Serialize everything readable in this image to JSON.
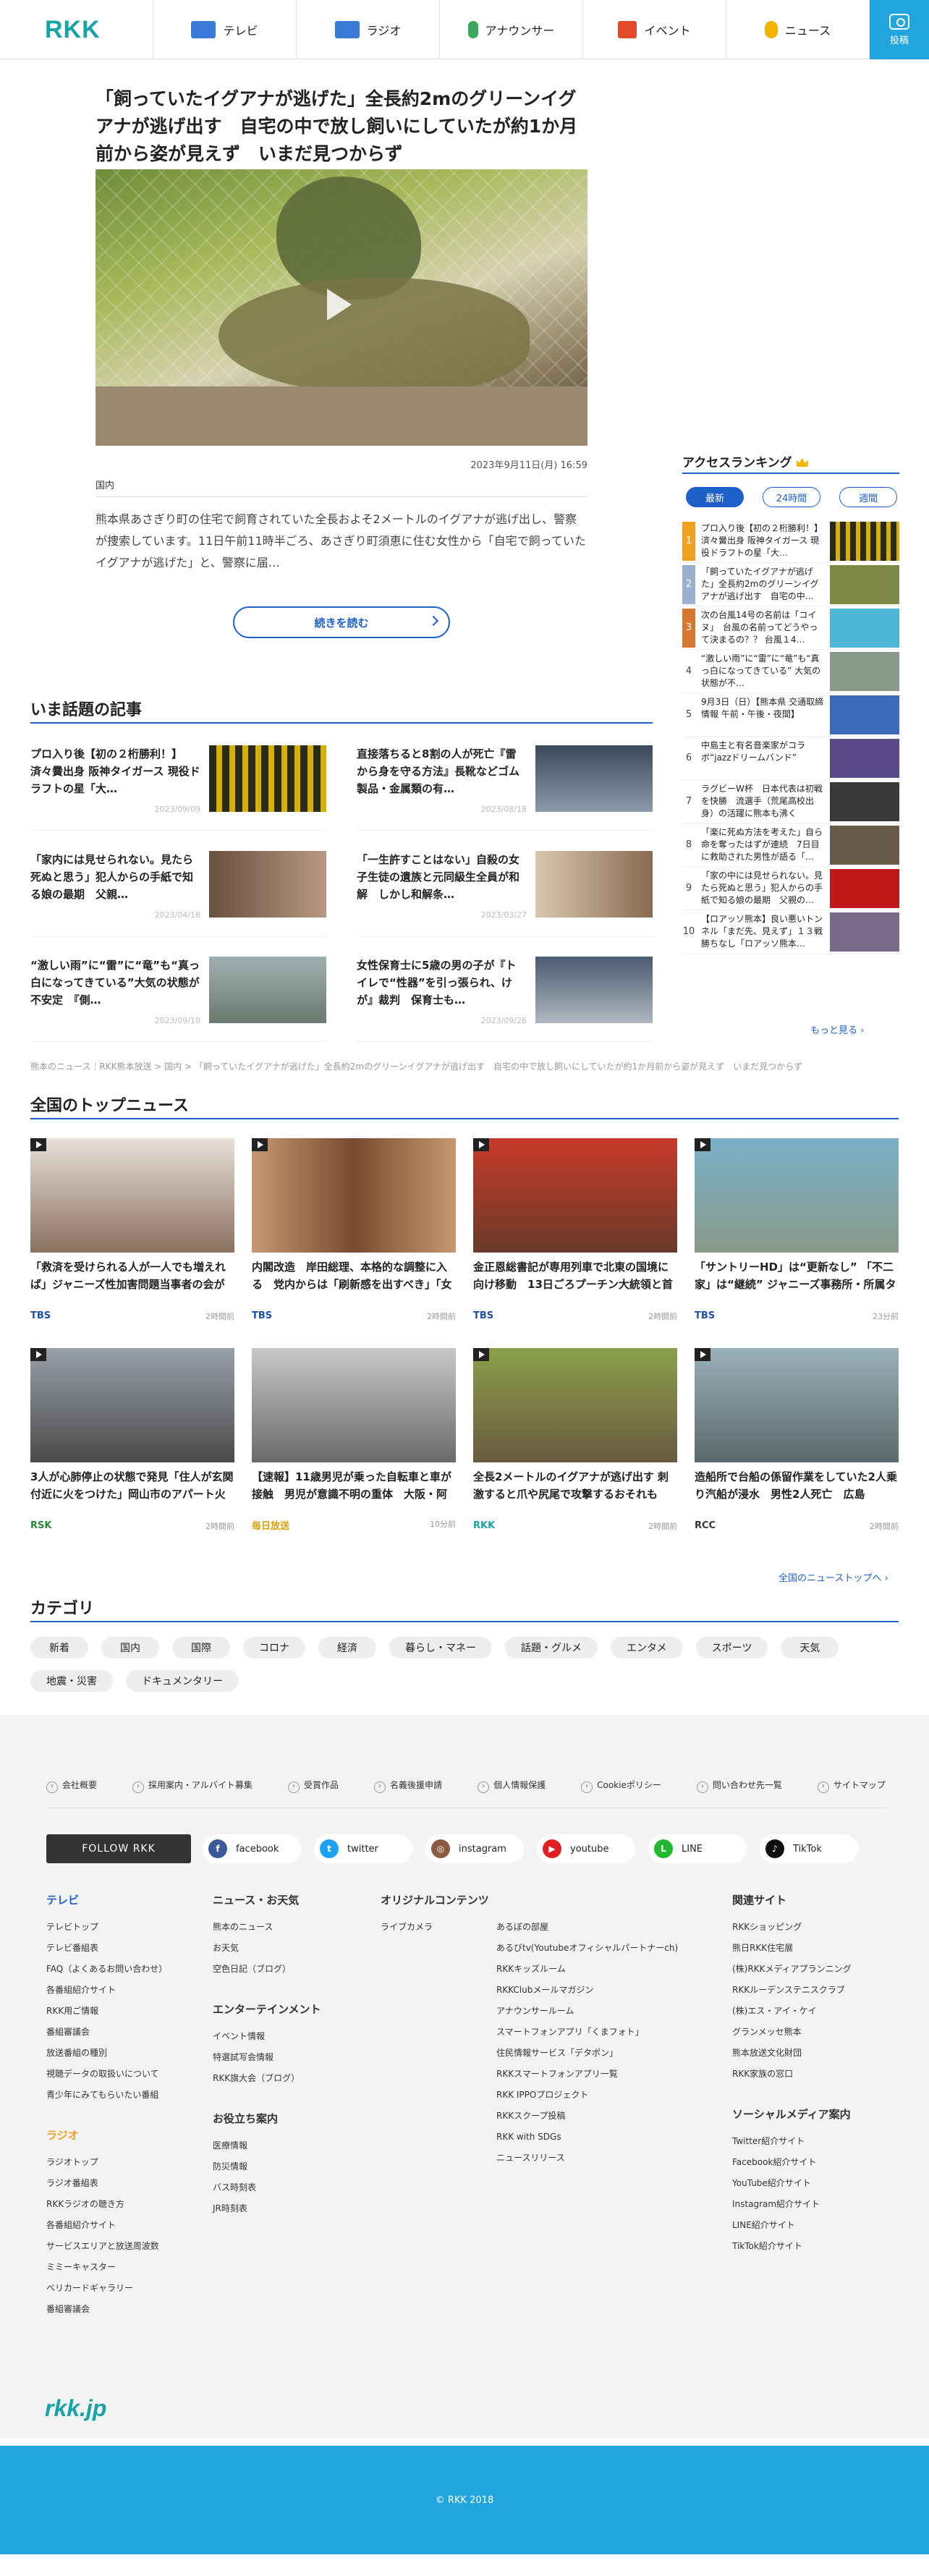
{
  "header": {
    "logo": "RKK",
    "nav": [
      {
        "label": "テレビ",
        "icon": "tv-icon",
        "color": "#3b7bd8"
      },
      {
        "label": "ラジオ",
        "icon": "radio-icon",
        "color": "#3b7bd8"
      },
      {
        "label": "アナウンサー",
        "icon": "microphone-icon",
        "color": "#3aa85c"
      },
      {
        "label": "イベント",
        "icon": "flag-icon",
        "color": "#e04a2a"
      },
      {
        "label": "ニュース",
        "icon": "lightbulb-icon",
        "color": "#f0b400"
      }
    ],
    "post_label": "投稿"
  },
  "article": {
    "title": "「飼っていたイグアナが逃げた」全長約2mのグリーンイグアナが逃げ出す　自宅の中で放し飼いにしていたが約1か月前から姿が見えず　いまだ見つからず",
    "date": "2023年9月11日(月) 16:59",
    "category": "国内",
    "summary": "熊本県あさぎり町の住宅で飼育されていた全長およそ2メートルのイグアナが逃げ出し、警察が捜索しています。11日午前11時半ごろ、あさぎり町須恵に住む女性から「自宅で飼っていたイグアナが逃げた」と、警察に届…",
    "more_label": "続きを読む"
  },
  "ranking": {
    "title": "アクセスランキング",
    "tabs": [
      "最新",
      "24時間",
      "週間"
    ],
    "items": [
      {
        "num": "1",
        "text": "プロ入り後【初の２桁勝利！】済々黌出身 阪神タイガース 現役ドラフトの星「大…",
        "color": "#2a2a1a"
      },
      {
        "num": "2",
        "text": "「飼っていたイグアナが逃げた」全長約2mのグリーンイグアナが逃げ出す　自宅の中…",
        "color": "#7c8a46"
      },
      {
        "num": "3",
        "text": "次の台風14号の名前は「コイヌ」　台風の名前ってどうやって決まるの？？ 台風１4…",
        "color": "#4fb6d8"
      },
      {
        "num": "4",
        "text": "“激しい雨”に“雷”に“竜”も“真っ白になってきている” 大気の状態が不…",
        "color": "#8a9a8a"
      },
      {
        "num": "5",
        "text": "9月3日（日）【熊本県 交通取締情報 午前・午後・夜間】",
        "color": "#3a6ab8"
      },
      {
        "num": "6",
        "text": "中島主と有名音楽家がコラボ“jazzドリームバンド”",
        "color": "#5a4a8a"
      },
      {
        "num": "7",
        "text": "ラグビーW杯　日本代表は初戦を快勝　流選手（荒尾高校出身）の活躍に熊本も沸く",
        "color": "#3a3a3a"
      },
      {
        "num": "8",
        "text": "「楽に死ぬ方法を考えた」自ら命を奪ったはずが連続　7日目に救助された男性が語る「…",
        "color": "#6a5a4a"
      },
      {
        "num": "9",
        "text": "「家の中には見せられない。見たら死ぬと思う」犯人からの手紙で知る娘の最期　父親の…",
        "color": "#c01818"
      },
      {
        "num": "10",
        "text": "【ロアッソ熊本】良い悪いトンネル「まだ先、見えず」１３戦勝ちなし「ロアッソ熊本…",
        "color": "#7a6a8a"
      }
    ],
    "more_label": "もっと見る ›"
  },
  "trending": {
    "title": "いま話題の記事",
    "items": [
      {
        "title": "プロ入り後【初の２桁勝利！】済々黌出身 阪神タイガース 現役ドラフトの星「大…",
        "date": "2023/09/09",
        "color": "#d8b000"
      },
      {
        "title": "直接落ちると8割の人が死亡『雷から身を守る方法』長靴などゴム製品・金属類の有…",
        "date": "2023/08/18",
        "color": "#5c6a7a"
      },
      {
        "title": "「家内には見せられない。見たら死ぬと思う」犯人からの手紙で知る娘の最期　父親…",
        "date": "2023/04/18",
        "color": "#6a5040"
      },
      {
        "title": "「一生許すことはない」自殺の女子生徒の遺族と元同級生全員が和解　しかし和解条…",
        "date": "2023/03/27",
        "color": "#b8a890"
      },
      {
        "title": "“激しい雨”に“雷”に“竜”も“真っ白になってきている”大気の状態が不安定　『側…",
        "date": "2023/09/10",
        "color": "#8a9a90"
      },
      {
        "title": "女性保育士に5歳の男の子が『トイレで“性器”を引っ張られ、けが』裁判　保育士も…",
        "date": "2023/09/26",
        "color": "#6a7a8a"
      }
    ]
  },
  "breadcrumb": "熊本のニュース｜RKK熊本放送 > 国内 > 「飼っていたイグアナが逃げた」全長約2mのグリーンイグアナが逃げ出す　自宅の中で放し飼いにしていたが約1か月前から姿が見えず　いまだ見つからず",
  "national": {
    "title": "全国のトップニュース",
    "items": [
      {
        "title": "「救済を受けられる人が一人でも増えれば」ジャニーズ性加害問題当事者の会が日弁連に対し人権救済申し立て",
        "source": "TBS",
        "time": "2時間前",
        "color": "#8a7060",
        "src_color": "#1f4fa8"
      },
      {
        "title": "内閣改造　岸田総理、本格的な調整に入る　党内からは「刷新感を出すべき」「女性閣僚を増やすべき」など…",
        "source": "TBS",
        "time": "2時間前",
        "color": "#7a4a30",
        "src_color": "#1f4fa8"
      },
      {
        "title": "金正恩総書記が専用列車で北東の国境に向け移動　13日ごろプーチン大統領と首脳会談か　韓国メディアが報道",
        "source": "TBS",
        "time": "2時間前",
        "color": "#8a3a2a",
        "src_color": "#1f4fa8"
      },
      {
        "title": "「サントリーHD」は“更新なし” 「不二家」は“継続” ジャニーズ事務所・所属タレントの広告契約で対応わかれる",
        "source": "TBS",
        "time": "23分前",
        "color": "#6a8a9a",
        "src_color": "#1f4fa8"
      },
      {
        "title": "3人が心肺停止の状態で発見「住人が玄関付近に火をつけた」岡山市のアパート火災",
        "source": "RSK",
        "time": "2時間前",
        "color": "#5a5a5a",
        "src_color": "#2a8a3a"
      },
      {
        "title": "【速報】11歳男児が乗った自転車と車が接触　男児が意識不明の重体　大阪・阿倍野区",
        "source": "毎日放送",
        "time": "10分前",
        "color": "#9a9a9a",
        "src_color": "#d8a000"
      },
      {
        "title": "全長2メートルのイグアナが逃げ出す 刺激すると爪や尻尾で攻撃するおそれも　熊本",
        "source": "RKK",
        "time": "2時間前",
        "color": "#6a7a3a",
        "src_color": "#18a3a8"
      },
      {
        "title": "造船所で台船の係留作業をしていた2人乗り汽船が浸水　男性2人死亡　広島",
        "source": "RCC",
        "time": "2時間前",
        "color": "#6a7a80",
        "src_color": "#333333"
      }
    ],
    "more_label": "全国のニューストップへ ›"
  },
  "categories": {
    "title": "カテゴリ",
    "items": [
      "新着",
      "国内",
      "国際",
      "コロナ",
      "経済",
      "暮らし・マネー",
      "話題・グルメ",
      "エンタメ",
      "スポーツ",
      "天気",
      "地震・災害",
      "ドキュメンタリー"
    ]
  },
  "footer": {
    "links": [
      "会社概要",
      "採用案内・アルバイト募集",
      "受賞作品",
      "名義後援申請",
      "個人情報保護",
      "Cookieポリシー",
      "問い合わせ先一覧",
      "サイトマップ"
    ],
    "follow_label": "FOLLOW RKK",
    "socials": [
      {
        "label": "facebook",
        "icon": "facebook-icon",
        "color": "#3b5998",
        "glyph": "f"
      },
      {
        "label": "twitter",
        "icon": "twitter-icon",
        "color": "#1da1f2",
        "glyph": "t"
      },
      {
        "label": "instagram",
        "icon": "instagram-icon",
        "color": "#8a5a44",
        "glyph": "◎"
      },
      {
        "label": "youtube",
        "icon": "youtube-icon",
        "color": "#e02020",
        "glyph": "▶"
      },
      {
        "label": "LINE",
        "icon": "line-icon",
        "color": "#22b830",
        "glyph": "L"
      },
      {
        "label": "TikTok",
        "icon": "tiktok-icon",
        "color": "#111111",
        "glyph": "♪"
      }
    ],
    "tv": {
      "title": "テレビ",
      "items": [
        "テレビトップ",
        "テレビ番組表",
        "FAQ（よくあるお問い合わせ）",
        "各番組紹介サイト",
        "RKK用ご情報",
        "番組審議会",
        "放送番組の種別",
        "視聴データの取扱いについて",
        "青少年にみてもらいたい番組"
      ]
    },
    "radio": {
      "title": "ラジオ",
      "items": [
        "ラジオトップ",
        "ラジオ番組表",
        "RKKラジオの聴き方",
        "各番組紹介サイト",
        "サービスエリアと放送周波数",
        "ミミーキャスター",
        "ベリカードギャラリー",
        "番組審議会"
      ]
    },
    "news": {
      "title": "ニュース・お天気",
      "items": [
        "熊本のニュース",
        "お天気",
        "空色日記（ブログ）"
      ]
    },
    "ent": {
      "title": "エンターテインメント",
      "items": [
        "イベント情報",
        "特選試写会情報",
        "RKK旗大会（ブログ）"
      ]
    },
    "useful": {
      "title": "お役立ち案内",
      "items": [
        "医療情報",
        "防災情報",
        "バス時刻表",
        "JR時刻表"
      ]
    },
    "original": {
      "title": "オリジナルコンテンツ",
      "items": [
        "ライブカメラ"
      ]
    },
    "original2": {
      "items": [
        "あるぼの部屋",
        "あるびtv(Youtubeオフィシャルパートナーch)",
        "RKKキッズルーム",
        "RKKClubメールマガジン",
        "アナウンサールーム",
        "スマートフォンアプリ「くまフォト」",
        "住民情報サービス「デタポン」",
        "RKKスマートフォンアプリ一覧",
        "RKK IPPOプロジェクト",
        "RKKスクープ投稿",
        "RKK with SDGs",
        "ニュースリリース"
      ]
    },
    "related": {
      "title": "関連サイト",
      "items": [
        "RKKショッピング",
        "熊日RKK住宅展",
        "(株)RKKメディアプランニング",
        "RKKルーデンステニスクラブ",
        "(株)エス・アイ・ケイ",
        "グランメッセ熊本",
        "熊本放送文化財団",
        "RKK家族の窓口"
      ]
    },
    "social_guide": {
      "title": "ソーシャルメディア案内",
      "items": [
        "Twitter紹介サイト",
        "Facebook紹介サイト",
        "YouTube紹介サイト",
        "Instagram紹介サイト",
        "LINE紹介サイト",
        "TikTok紹介サイト"
      ]
    },
    "logo": "rkk.jp",
    "copyright": "© RKK 2018"
  }
}
